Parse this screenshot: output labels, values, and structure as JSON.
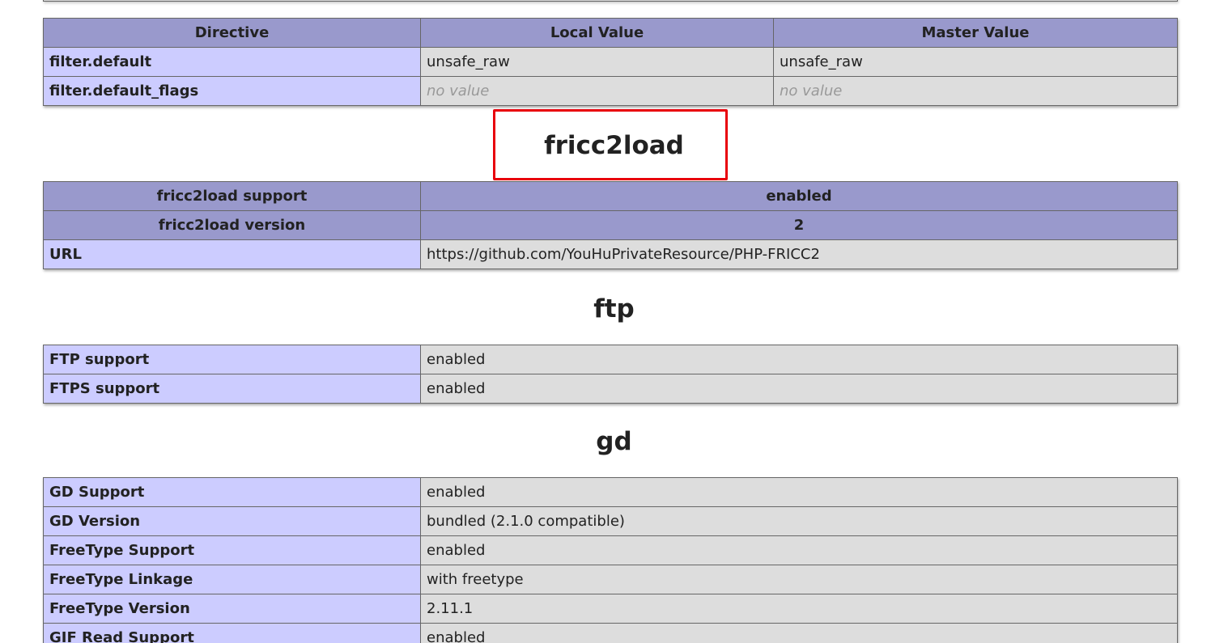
{
  "filter_table": {
    "headers": [
      "Directive",
      "Local Value",
      "Master Value"
    ],
    "rows": [
      {
        "directive": "filter.default",
        "local": "unsafe_raw",
        "master": "unsafe_raw"
      },
      {
        "directive": "filter.default_flags",
        "local": "no value",
        "master": "no value"
      }
    ]
  },
  "fricc2load": {
    "title": "fricc2load",
    "support_label": "fricc2load support",
    "support_value": "enabled",
    "version_label": "fricc2load version",
    "version_value": "2",
    "url_label": "URL",
    "url_value": "https://github.com/YouHuPrivateResource/PHP-FRICC2",
    "highlight_color": "#e8000b"
  },
  "ftp": {
    "title": "ftp",
    "rows": [
      {
        "label": "FTP support",
        "value": "enabled"
      },
      {
        "label": "FTPS support",
        "value": "enabled"
      }
    ]
  },
  "gd": {
    "title": "gd",
    "rows": [
      {
        "label": "GD Support",
        "value": "enabled"
      },
      {
        "label": "GD Version",
        "value": "bundled (2.1.0 compatible)"
      },
      {
        "label": "FreeType Support",
        "value": "enabled"
      },
      {
        "label": "FreeType Linkage",
        "value": "with freetype"
      },
      {
        "label": "FreeType Version",
        "value": "2.11.1"
      },
      {
        "label": "GIF Read Support",
        "value": "enabled"
      }
    ]
  },
  "colors": {
    "header_bg": "#9999cc",
    "label_bg": "#ccccff",
    "value_bg": "#dddddd"
  }
}
